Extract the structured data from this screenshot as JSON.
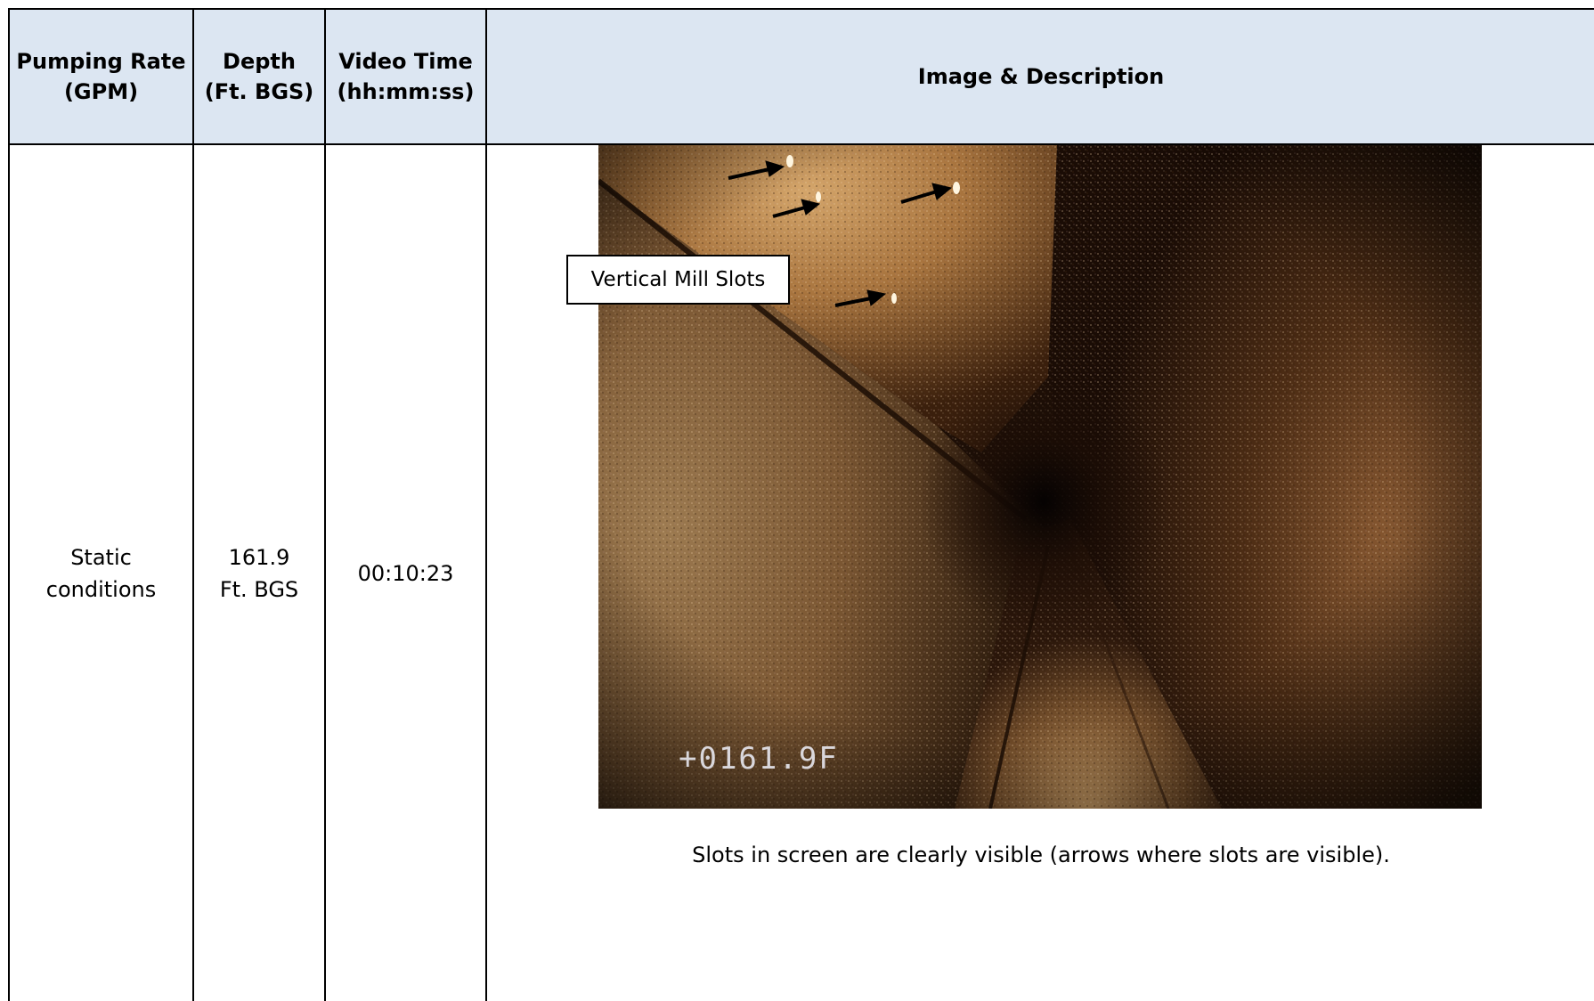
{
  "table": {
    "headers": {
      "pumping_rate": "Pumping Rate (GPM)",
      "depth": "Depth (Ft. BGS)",
      "video_time": "Video Time (hh:mm:ss)",
      "image_description": "Image & Description"
    },
    "row": {
      "pumping_rate": "Static conditions",
      "depth": "161.9 Ft. BGS",
      "video_time": "00:10:23",
      "callout_label": "Vertical Mill Slots",
      "depth_overlay": "+0161.9F",
      "caption": "Slots in screen are clearly visible (arrows where slots are visible)."
    }
  },
  "colors": {
    "header_fill": "#dce6f2",
    "border": "#000000",
    "arrow": "#000000",
    "casing_light": "#c8965a",
    "casing_dark": "#2a1608"
  },
  "icons": {
    "arrow": "arrow-right-icon"
  }
}
